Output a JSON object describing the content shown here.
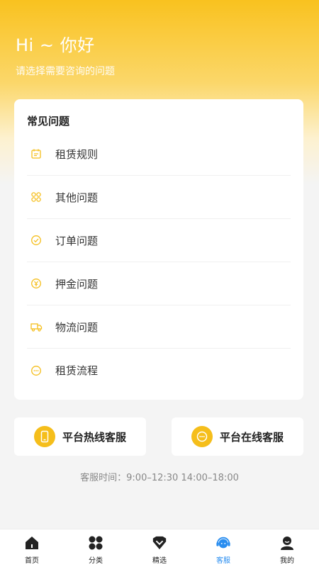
{
  "hero": {
    "greeting": "Hi ~ 你好",
    "subtitle": "请选择需要咨询的问题"
  },
  "faq": {
    "title": "常见问题",
    "items": [
      {
        "label": "租赁规则",
        "icon": "calendar-icon"
      },
      {
        "label": "其他问题",
        "icon": "grid-icon"
      },
      {
        "label": "订单问题",
        "icon": "check-circle-icon"
      },
      {
        "label": "押金问题",
        "icon": "deposit-icon"
      },
      {
        "label": "物流问题",
        "icon": "truck-icon"
      },
      {
        "label": "租赁流程",
        "icon": "chat-bubble-icon"
      }
    ]
  },
  "service": {
    "hotline_label": "平台热线客服",
    "online_label": "平台在线客服",
    "hours": "客服时间：9:00–12:30 14:00–18:00"
  },
  "tabbar": {
    "items": [
      {
        "label": "首页",
        "icon": "home-icon"
      },
      {
        "label": "分类",
        "icon": "category-icon"
      },
      {
        "label": "精选",
        "icon": "heart-icon"
      },
      {
        "label": "客服",
        "icon": "headset-icon",
        "active": true
      },
      {
        "label": "我的",
        "icon": "user-icon"
      }
    ]
  },
  "colors": {
    "accent": "#f5be1b",
    "active_tab": "#2a8ef0"
  }
}
